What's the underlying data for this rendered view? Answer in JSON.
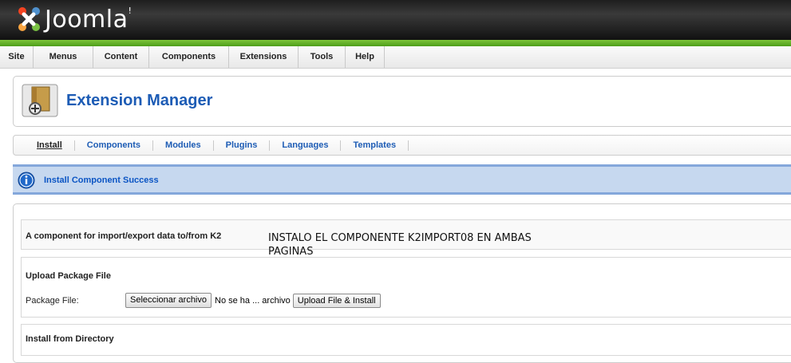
{
  "brand": {
    "name": "Joomla",
    "mark": "!"
  },
  "menu": [
    {
      "label": "Site",
      "w": 42
    },
    {
      "label": "Menus",
      "w": 75
    },
    {
      "label": "Content",
      "w": 70
    },
    {
      "label": "Components",
      "w": 100
    },
    {
      "label": "Extensions",
      "w": 87
    },
    {
      "label": "Tools",
      "w": 59
    },
    {
      "label": "Help",
      "w": 49
    }
  ],
  "page": {
    "title": "Extension Manager",
    "icon": "extension-manager-icon"
  },
  "submenu": [
    "Install",
    "Components",
    "Modules",
    "Plugins",
    "Languages",
    "Templates"
  ],
  "message": {
    "text": "Install Component Success",
    "icon": "info-icon"
  },
  "component": {
    "description": "A component for import/export data to/from K2"
  },
  "note": {
    "text": "INSTALO EL COMPONENTE K2IMPORT08 EN AMBAS PAGINAS"
  },
  "upload": {
    "heading": "Upload Package File",
    "field_label": "Package File:",
    "choose_label": "Seleccionar archivo",
    "file_status": "No se ha ... archivo",
    "button_label": "Upload File & Install"
  },
  "directory": {
    "heading": "Install from Directory"
  },
  "colors": {
    "accent": "#1d5cb5",
    "green": "#6cb52c",
    "message_bg": "#c6d8ef"
  }
}
